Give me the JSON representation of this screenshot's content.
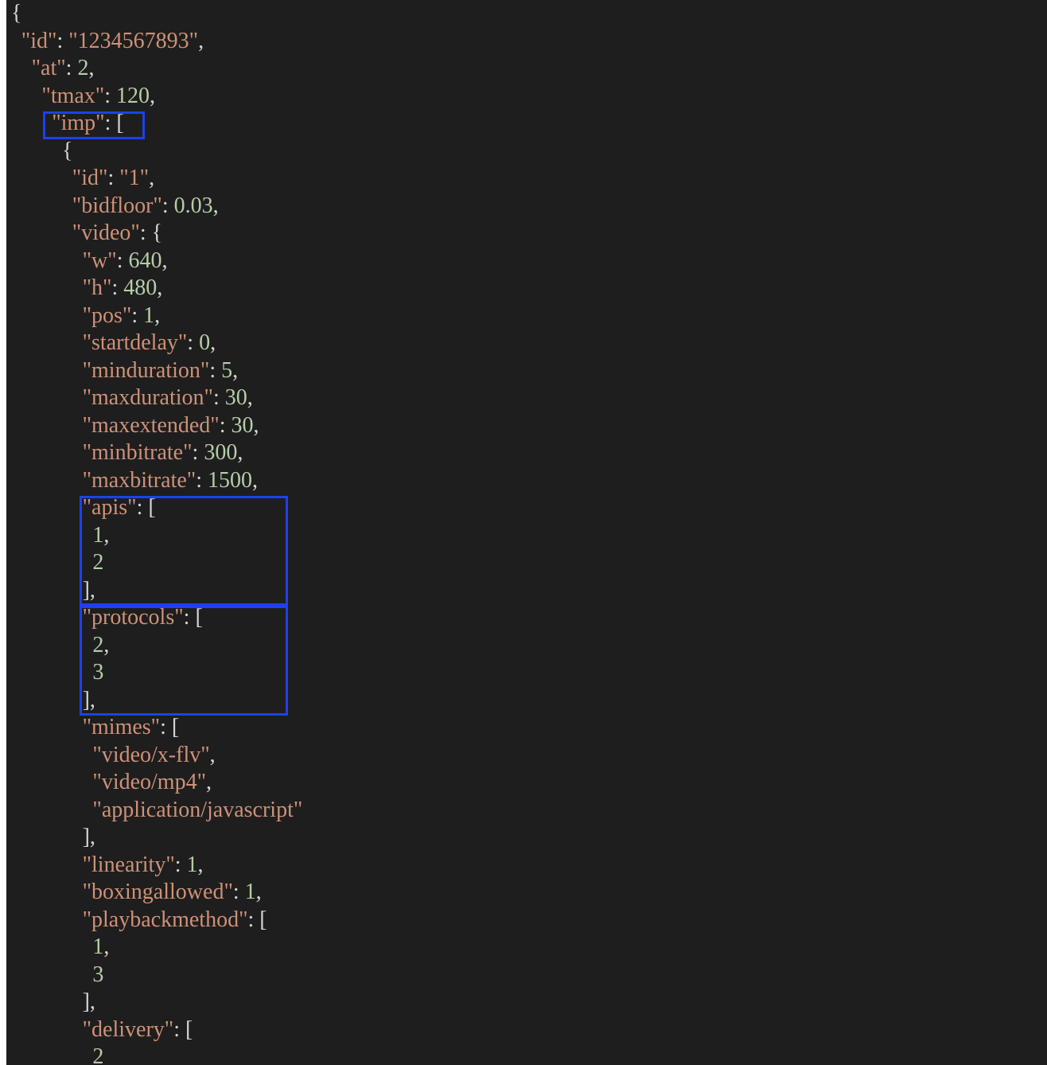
{
  "code_lines": [
    {
      "indent": 0,
      "parts": [
        {
          "t": "pun",
          "v": "{"
        }
      ]
    },
    {
      "indent": 1,
      "parts": [
        {
          "t": "key",
          "v": "\"id\""
        },
        {
          "t": "pun",
          "v": ": "
        },
        {
          "t": "str",
          "v": "\"1234567893\""
        },
        {
          "t": "pun",
          "v": ","
        }
      ]
    },
    {
      "indent": 2,
      "parts": [
        {
          "t": "key",
          "v": "\"at\""
        },
        {
          "t": "pun",
          "v": ": "
        },
        {
          "t": "num",
          "v": "2"
        },
        {
          "t": "pun",
          "v": ","
        }
      ]
    },
    {
      "indent": 3,
      "parts": [
        {
          "t": "key",
          "v": "\"tmax\""
        },
        {
          "t": "pun",
          "v": ": "
        },
        {
          "t": "num",
          "v": "120"
        },
        {
          "t": "pun",
          "v": ","
        }
      ]
    },
    {
      "indent": 4,
      "parts": [
        {
          "t": "key",
          "v": "\"imp\""
        },
        {
          "t": "pun",
          "v": ": ["
        }
      ]
    },
    {
      "indent": 5,
      "parts": [
        {
          "t": "pun",
          "v": "{"
        }
      ]
    },
    {
      "indent": 6,
      "parts": [
        {
          "t": "key",
          "v": "\"id\""
        },
        {
          "t": "pun",
          "v": ": "
        },
        {
          "t": "str",
          "v": "\"1\""
        },
        {
          "t": "pun",
          "v": ","
        }
      ]
    },
    {
      "indent": 6,
      "parts": [
        {
          "t": "key",
          "v": "\"bidfloor\""
        },
        {
          "t": "pun",
          "v": ": "
        },
        {
          "t": "num",
          "v": "0.03"
        },
        {
          "t": "pun",
          "v": ","
        }
      ]
    },
    {
      "indent": 6,
      "parts": [
        {
          "t": "key",
          "v": "\"video\""
        },
        {
          "t": "pun",
          "v": ": {"
        }
      ]
    },
    {
      "indent": 7,
      "parts": [
        {
          "t": "key",
          "v": "\"w\""
        },
        {
          "t": "pun",
          "v": ": "
        },
        {
          "t": "num",
          "v": "640"
        },
        {
          "t": "pun",
          "v": ","
        }
      ]
    },
    {
      "indent": 7,
      "parts": [
        {
          "t": "key",
          "v": "\"h\""
        },
        {
          "t": "pun",
          "v": ": "
        },
        {
          "t": "num",
          "v": "480"
        },
        {
          "t": "pun",
          "v": ","
        }
      ]
    },
    {
      "indent": 7,
      "parts": [
        {
          "t": "key",
          "v": "\"pos\""
        },
        {
          "t": "pun",
          "v": ": "
        },
        {
          "t": "num",
          "v": "1"
        },
        {
          "t": "pun",
          "v": ","
        }
      ]
    },
    {
      "indent": 7,
      "parts": [
        {
          "t": "key",
          "v": "\"startdelay\""
        },
        {
          "t": "pun",
          "v": ": "
        },
        {
          "t": "num",
          "v": "0"
        },
        {
          "t": "pun",
          "v": ","
        }
      ]
    },
    {
      "indent": 7,
      "parts": [
        {
          "t": "key",
          "v": "\"minduration\""
        },
        {
          "t": "pun",
          "v": ": "
        },
        {
          "t": "num",
          "v": "5"
        },
        {
          "t": "pun",
          "v": ","
        }
      ]
    },
    {
      "indent": 7,
      "parts": [
        {
          "t": "key",
          "v": "\"maxduration\""
        },
        {
          "t": "pun",
          "v": ": "
        },
        {
          "t": "num",
          "v": "30"
        },
        {
          "t": "pun",
          "v": ","
        }
      ]
    },
    {
      "indent": 7,
      "parts": [
        {
          "t": "key",
          "v": "\"maxextended\""
        },
        {
          "t": "pun",
          "v": ": "
        },
        {
          "t": "num",
          "v": "30"
        },
        {
          "t": "pun",
          "v": ","
        }
      ]
    },
    {
      "indent": 7,
      "parts": [
        {
          "t": "key",
          "v": "\"minbitrate\""
        },
        {
          "t": "pun",
          "v": ": "
        },
        {
          "t": "num",
          "v": "300"
        },
        {
          "t": "pun",
          "v": ","
        }
      ]
    },
    {
      "indent": 7,
      "parts": [
        {
          "t": "key",
          "v": "\"maxbitrate\""
        },
        {
          "t": "pun",
          "v": ": "
        },
        {
          "t": "num",
          "v": "1500"
        },
        {
          "t": "pun",
          "v": ","
        }
      ]
    },
    {
      "indent": 7,
      "parts": [
        {
          "t": "key",
          "v": "\"apis\""
        },
        {
          "t": "pun",
          "v": ": ["
        }
      ]
    },
    {
      "indent": 8,
      "parts": [
        {
          "t": "num",
          "v": "1"
        },
        {
          "t": "pun",
          "v": ","
        }
      ]
    },
    {
      "indent": 8,
      "parts": [
        {
          "t": "num",
          "v": "2"
        }
      ]
    },
    {
      "indent": 7,
      "parts": [
        {
          "t": "pun",
          "v": "],"
        }
      ]
    },
    {
      "indent": 7,
      "parts": [
        {
          "t": "key",
          "v": "\"protocols\""
        },
        {
          "t": "pun",
          "v": ": ["
        }
      ]
    },
    {
      "indent": 8,
      "parts": [
        {
          "t": "num",
          "v": "2"
        },
        {
          "t": "pun",
          "v": ","
        }
      ]
    },
    {
      "indent": 8,
      "parts": [
        {
          "t": "num",
          "v": "3"
        }
      ]
    },
    {
      "indent": 7,
      "parts": [
        {
          "t": "pun",
          "v": "],"
        }
      ]
    },
    {
      "indent": 7,
      "parts": [
        {
          "t": "key",
          "v": "\"mimes\""
        },
        {
          "t": "pun",
          "v": ": ["
        }
      ]
    },
    {
      "indent": 8,
      "parts": [
        {
          "t": "str",
          "v": "\"video/x-flv\""
        },
        {
          "t": "pun",
          "v": ","
        }
      ]
    },
    {
      "indent": 8,
      "parts": [
        {
          "t": "str",
          "v": "\"video/mp4\""
        },
        {
          "t": "pun",
          "v": ","
        }
      ]
    },
    {
      "indent": 8,
      "parts": [
        {
          "t": "str",
          "v": "\"application/javascript\""
        }
      ]
    },
    {
      "indent": 7,
      "parts": [
        {
          "t": "pun",
          "v": "],"
        }
      ]
    },
    {
      "indent": 7,
      "parts": [
        {
          "t": "key",
          "v": "\"linearity\""
        },
        {
          "t": "pun",
          "v": ": "
        },
        {
          "t": "num",
          "v": "1"
        },
        {
          "t": "pun",
          "v": ","
        }
      ]
    },
    {
      "indent": 7,
      "parts": [
        {
          "t": "key",
          "v": "\"boxingallowed\""
        },
        {
          "t": "pun",
          "v": ": "
        },
        {
          "t": "num",
          "v": "1"
        },
        {
          "t": "pun",
          "v": ","
        }
      ]
    },
    {
      "indent": 7,
      "parts": [
        {
          "t": "key",
          "v": "\"playbackmethod\""
        },
        {
          "t": "pun",
          "v": ": ["
        }
      ]
    },
    {
      "indent": 8,
      "parts": [
        {
          "t": "num",
          "v": "1"
        },
        {
          "t": "pun",
          "v": ","
        }
      ]
    },
    {
      "indent": 8,
      "parts": [
        {
          "t": "num",
          "v": "3"
        }
      ]
    },
    {
      "indent": 7,
      "parts": [
        {
          "t": "pun",
          "v": "],"
        }
      ]
    },
    {
      "indent": 7,
      "parts": [
        {
          "t": "key",
          "v": "\"delivery\""
        },
        {
          "t": "pun",
          "v": ": ["
        }
      ]
    },
    {
      "indent": 8,
      "parts": [
        {
          "t": "num",
          "v": "2"
        }
      ]
    }
  ],
  "highlight_boxes": [
    {
      "name": "imp-highlight-box",
      "first_line": 4,
      "last_line": 4
    },
    {
      "name": "apis-highlight-box",
      "first_line": 18,
      "last_line": 21
    },
    {
      "name": "protocols-highlight-box",
      "first_line": 22,
      "last_line": 25
    }
  ],
  "colors": {
    "background": "#1e1e1e",
    "key_string": "#ce9178",
    "number": "#b5cea8",
    "punctuation": "#d4d4d4",
    "highlight_border": "#1f3ff0"
  }
}
